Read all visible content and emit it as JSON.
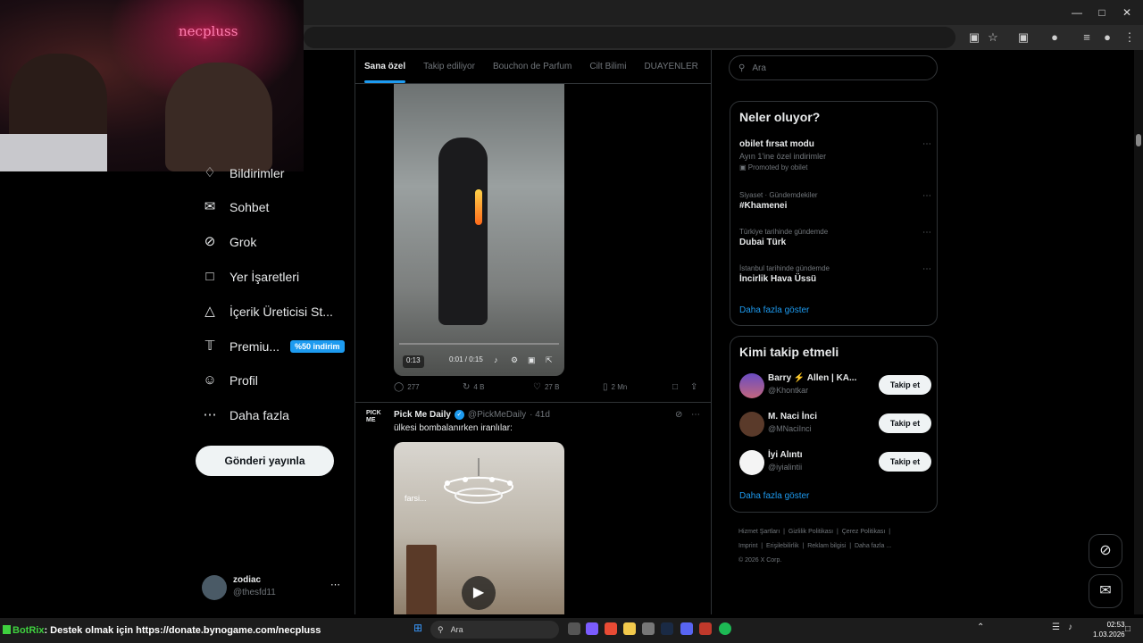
{
  "webcam": {
    "brand": "necpluss"
  },
  "nav": {
    "items": [
      {
        "label": "Bildirimler",
        "icon": "bell-icon"
      },
      {
        "label": "Sohbet",
        "icon": "mail-icon"
      },
      {
        "label": "Grok",
        "icon": "grok-icon"
      },
      {
        "label": "Yer İşaretleri",
        "icon": "bookmark-icon"
      },
      {
        "label": "İçerik Üreticisi St...",
        "icon": "flask-icon"
      },
      {
        "label": "Premiu...",
        "icon": "x-logo-icon",
        "badge": "%50 indirim"
      },
      {
        "label": "Profil",
        "icon": "person-icon"
      },
      {
        "label": "Daha fazla",
        "icon": "more-circle-icon"
      }
    ],
    "post_button": "Gönderi yayınla",
    "account": {
      "name": "zodiac",
      "handle": "@thesfd11"
    }
  },
  "tabs": [
    "Sana özel",
    "Takip ediliyor",
    "Bouchon de Parfum",
    "Cilt Bilimi",
    "DUAYENLER"
  ],
  "tweet1": {
    "video": {
      "time_left": "0:13",
      "time_progress": "0:01 / 0:15"
    },
    "actions": {
      "replies": "277",
      "reposts": "4 B",
      "likes": "27 B",
      "views": "2 Mn"
    }
  },
  "tweet2": {
    "author": "Pick Me Daily",
    "handle": "@PickMeDaily",
    "time": "· 41d",
    "text": "ülkesi bombalanırken iranlılar:",
    "avatar_text": "PICK ME",
    "video_watermark": "farsi..."
  },
  "search": {
    "placeholder": "Ara"
  },
  "trends": {
    "title": "Neler oluyor?",
    "items": [
      {
        "name": "obilet fırsat modu",
        "sub": "Ayın 1'ine özel indirimler",
        "meta": "Promoted by obilet"
      },
      {
        "meta": "Siyaset · Gündemdekiler",
        "name": "#Khamenei"
      },
      {
        "meta": "Türkiye tarihinde gündemde",
        "name": "Dubai Türk"
      },
      {
        "meta": "İstanbul tarihinde gündemde",
        "name": "İncirlik Hava Üssü"
      }
    ],
    "show_more": "Daha fazla göster"
  },
  "who_to_follow": {
    "title": "Kimi takip etmeli",
    "items": [
      {
        "name": "Barry ⚡ Allen | KA...",
        "handle": "@Khontkar",
        "button": "Takip et"
      },
      {
        "name": "M. Naci İnci",
        "handle": "@MNaciInci",
        "button": "Takip et"
      },
      {
        "name": "İyi Alıntı",
        "handle": "@iyialintii",
        "button": "Takip et"
      }
    ],
    "show_more": "Daha fazla göster"
  },
  "footer": {
    "links": [
      "Hizmet Şartları",
      "Gizlilik Politikası",
      "Çerez Politikası",
      "Imprint",
      "Erişilebilirlik",
      "Reklam bilgisi",
      "Daha fazla ..."
    ],
    "copyright": "© 2026 X Corp."
  },
  "taskbar": {
    "bot_name": "BotRix",
    "ticker": ": Destek olmak için https://donate.bynogame.com/necpluss",
    "search_placeholder": "Ara",
    "time": "02:53",
    "date": "1.03.2026"
  },
  "colors": {
    "accent": "#1d9bf0",
    "background": "#000000",
    "border": "#2f3336",
    "muted": "#71767b"
  }
}
